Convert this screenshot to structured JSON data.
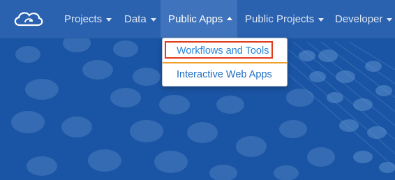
{
  "navbar": {
    "logo_icon": "cloud-logo-icon",
    "items": [
      {
        "label": "Projects",
        "has_caret": true
      },
      {
        "label": "Data",
        "has_caret": true
      },
      {
        "label": "Public Apps",
        "has_caret": true,
        "active": true
      },
      {
        "label": "Public Projects",
        "has_caret": true
      },
      {
        "label": "Developer",
        "has_caret": true
      }
    ]
  },
  "dropdown": {
    "items": [
      {
        "label": "Workflows and Tools",
        "highlighted": true
      },
      {
        "label": "Interactive Web Apps"
      }
    ]
  },
  "colors": {
    "background": "#1a55a5",
    "navbar": "#2a62b0",
    "active_nav": "#3f73bb",
    "link": "#1d6cc4",
    "highlight_border": "#e0391b",
    "divider": "#f0a02c"
  }
}
